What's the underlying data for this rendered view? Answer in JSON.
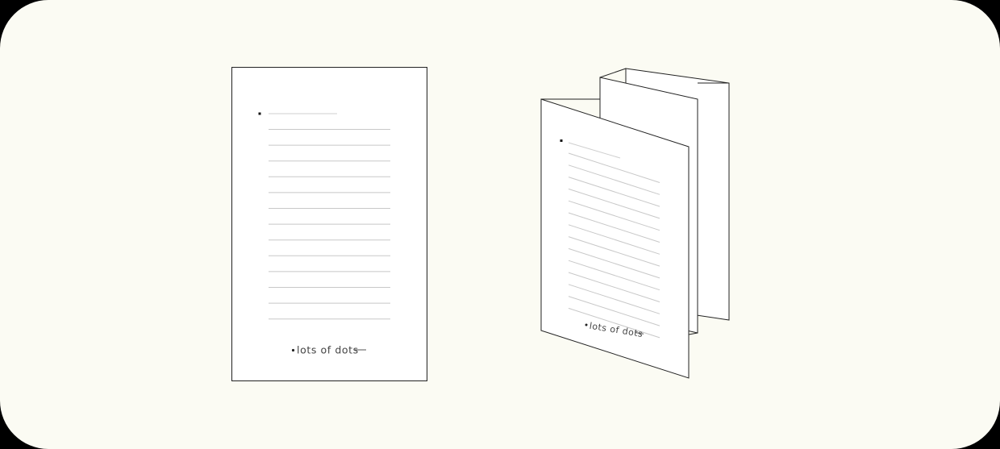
{
  "colors": {
    "background": "#fbfbf3",
    "page_fill": "#ffffff",
    "outline": "#222222",
    "rule_line": "#c8c8c8",
    "text": "#444444"
  },
  "flat_sheet": {
    "rule_count": 13,
    "footer_text": "lots of dots",
    "icon": "bullet-dot-icon"
  },
  "folded_booklet": {
    "panel_count": 3,
    "rule_count": 14,
    "footer_text": "lots of dots",
    "icon": "bullet-dot-icon"
  }
}
